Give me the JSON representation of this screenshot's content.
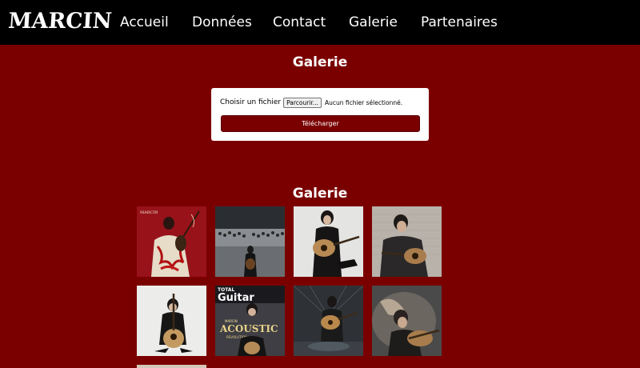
{
  "brand": {
    "logo_text": "MARCIN"
  },
  "nav": {
    "items": [
      {
        "label": "Accueil"
      },
      {
        "label": "Données"
      },
      {
        "label": "Contact"
      },
      {
        "label": "Galerie"
      },
      {
        "label": "Partenaires"
      }
    ]
  },
  "upload_section": {
    "title": "Galerie",
    "file_label": "Choisir un fichier",
    "browse_button": "Parcourir...",
    "file_status": "Aucun fichier sélectionné.",
    "submit_button": "Télécharger"
  },
  "gallery": {
    "title": "Galerie",
    "images": [
      {
        "caption": "",
        "cover_text": "MARCIN"
      },
      {
        "caption": ""
      },
      {
        "caption": ""
      },
      {
        "caption": ""
      },
      {
        "caption": ""
      },
      {
        "caption": "",
        "cover_text": "Guitar",
        "cover_top": "TOTAL",
        "cover_headline": "ACOUSTIC",
        "cover_sub": "MARCIN ",
        "cover_sub2": "REVOLUTION"
      },
      {
        "caption": ""
      },
      {
        "caption": ""
      }
    ]
  },
  "colors": {
    "background": "#7a0000",
    "navbar": "#000000",
    "card": "#ffffff",
    "button": "#7a0000"
  }
}
